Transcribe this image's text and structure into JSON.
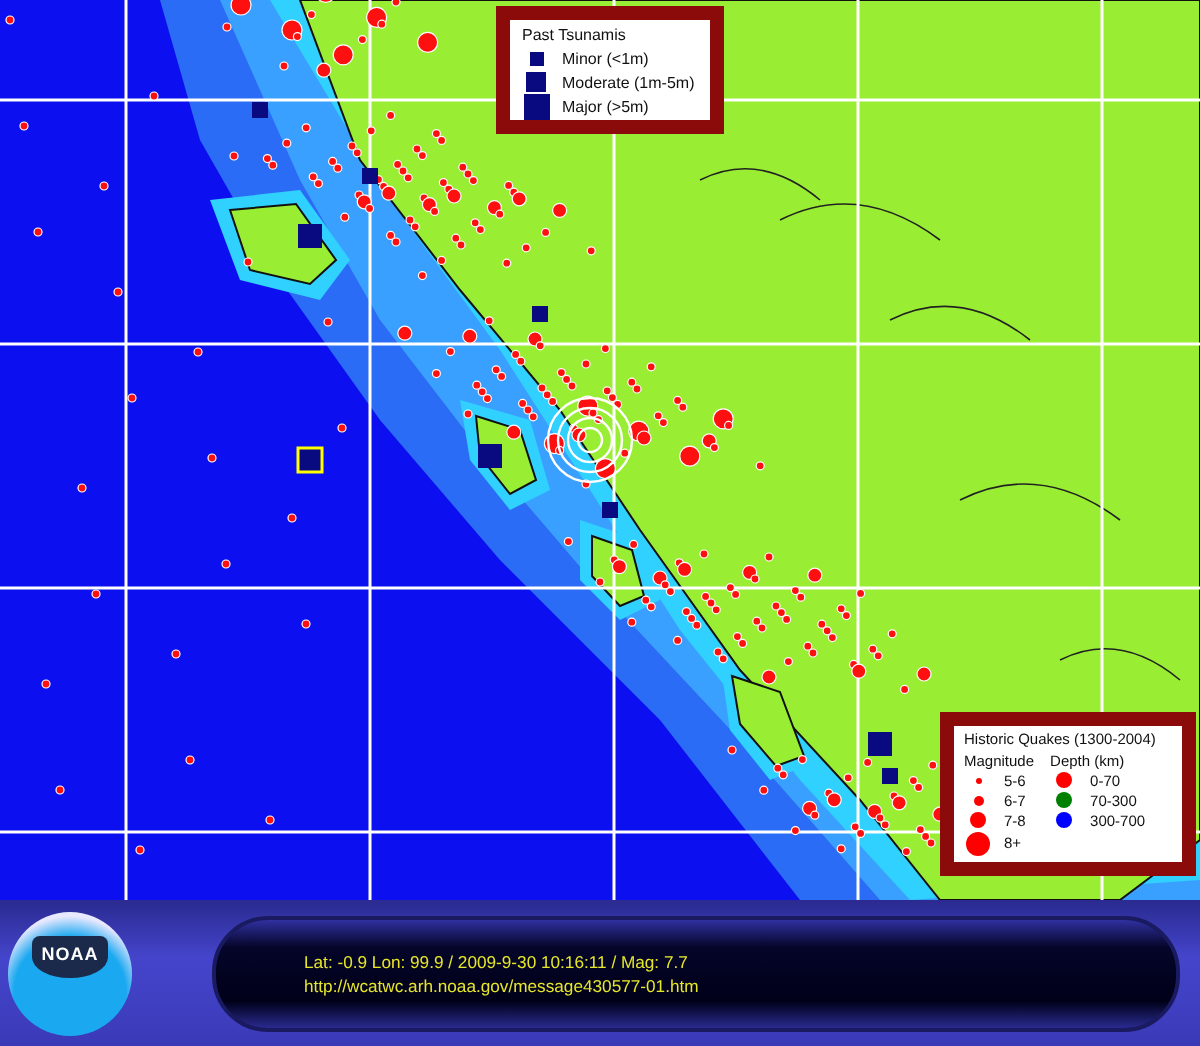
{
  "map": {
    "tsunami_legend": {
      "title": "Past Tsunamis",
      "items": [
        {
          "label": "Minor (<1m)",
          "kind": "minor"
        },
        {
          "label": "Moderate (1m-5m)",
          "kind": "moderate"
        },
        {
          "label": "Major (>5m)",
          "kind": "major"
        }
      ]
    },
    "quake_legend": {
      "title": "Historic Quakes (1300-2004)",
      "magnitude_heading": "Magnitude",
      "depth_heading": "Depth (km)",
      "magnitudes": [
        {
          "label": "5-6",
          "kind": "m5"
        },
        {
          "label": "6-7",
          "kind": "m6"
        },
        {
          "label": "7-8",
          "kind": "m7"
        },
        {
          "label": "8+",
          "kind": "m8"
        }
      ],
      "depths": [
        {
          "label": "0-70",
          "color": "#ff0000"
        },
        {
          "label": "70-300",
          "color": "#008000"
        },
        {
          "label": "300-700",
          "color": "#0000ff"
        }
      ]
    }
  },
  "footer": {
    "logo": "NOAA",
    "lines": [
      "Lat: -0.9 Lon: 99.9 / 2009-9-30 10:16:11 / Mag: 7.7",
      "http://wcatwc.arh.noaa.gov/message430577-01.htm"
    ]
  }
}
